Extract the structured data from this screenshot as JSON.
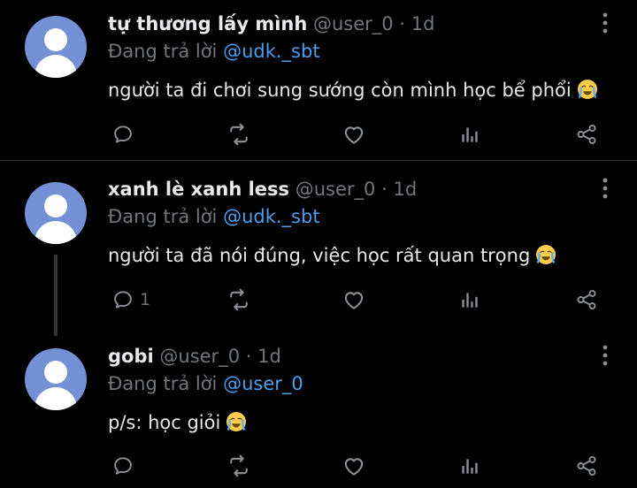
{
  "theme": {
    "background": "#000000",
    "text": "#e7e9ea",
    "muted": "#71767b",
    "link": "#4c9eeb",
    "avatar": "#7591d6"
  },
  "tweets": [
    {
      "name": "tự thương lấy mình",
      "handle": "@user_0",
      "separator": "·",
      "time": "1d",
      "reply_prefix": "Đang trả lời",
      "reply_to": "@udk._sbt",
      "text": "người ta đi chơi sung sướng còn mình học bể phổi",
      "emoji": "loudly-crying-face",
      "reply_count": ""
    },
    {
      "name": "xanh lè xanh less",
      "handle": "@user_0",
      "separator": "·",
      "time": "1d",
      "reply_prefix": "Đang trả lời",
      "reply_to": "@udk._sbt",
      "text": "người ta đã nói đúng, việc học rất quan trọng",
      "emoji": "loudly-crying-face",
      "reply_count": "1"
    },
    {
      "name": "gobi",
      "handle": "@user_0",
      "separator": "·",
      "time": "1d",
      "reply_prefix": "Đang trả lời",
      "reply_to": "@user_0",
      "text": "p/s: học giỏi",
      "emoji": "loudly-crying-face",
      "reply_count": ""
    }
  ],
  "icons": {
    "more": "more-vertical-icon",
    "reply": "reply-icon",
    "retweet": "retweet-icon",
    "like": "heart-icon",
    "views": "views-icon",
    "share": "share-icon"
  }
}
